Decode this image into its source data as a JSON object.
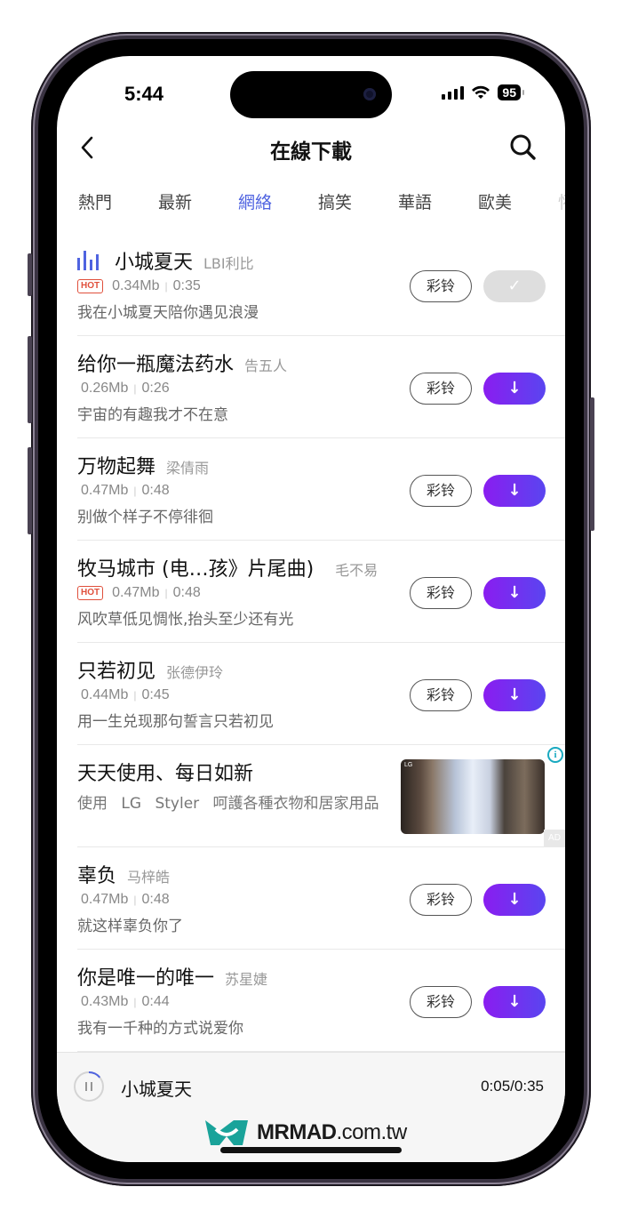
{
  "status_bar": {
    "time": "5:44",
    "battery": "95"
  },
  "header": {
    "title": "在線下載",
    "back_icon": "chevron-left-icon",
    "search_icon": "search-icon"
  },
  "tabs": [
    {
      "label": "熱門",
      "active": false
    },
    {
      "label": "最新",
      "active": false
    },
    {
      "label": "網絡",
      "active": true
    },
    {
      "label": "搞笑",
      "active": false
    },
    {
      "label": "華語",
      "active": false
    },
    {
      "label": "歐美",
      "active": false
    },
    {
      "label": "怀",
      "active": false
    }
  ],
  "songs": [
    {
      "title": "小城夏天",
      "artist": "LBI利比",
      "hot": true,
      "size": "0.34Mb",
      "duration": "0:35",
      "lyric": "我在小城夏天陪你遇见浪漫",
      "playing": true,
      "downloaded": true,
      "ring_label": "彩铃"
    },
    {
      "title": "给你一瓶魔法药水",
      "artist": "告五人",
      "hot": false,
      "size": "0.26Mb",
      "duration": "0:26",
      "lyric": "宇宙的有趣我才不在意",
      "playing": false,
      "downloaded": false,
      "ring_label": "彩铃"
    },
    {
      "title": "万物起舞",
      "artist": "梁倩雨",
      "hot": false,
      "size": "0.47Mb",
      "duration": "0:48",
      "lyric": "别做个样子不停徘徊",
      "playing": false,
      "downloaded": false,
      "ring_label": "彩铃"
    },
    {
      "title": "牧马城市 (电…孩》片尾曲)",
      "artist": "毛不易",
      "hot": true,
      "size": "0.47Mb",
      "duration": "0:48",
      "lyric": "风吹草低见惆怅,抬头至少还有光",
      "playing": false,
      "downloaded": false,
      "ring_label": "彩铃"
    },
    {
      "title": "只若初见",
      "artist": "张德伊玲",
      "hot": false,
      "size": "0.44Mb",
      "duration": "0:45",
      "lyric": "用一生兑现那句誓言只若初见",
      "playing": false,
      "downloaded": false,
      "ring_label": "彩铃"
    }
  ],
  "ad": {
    "title": "天天使用、每日如新",
    "description": "使用 LG Styler 呵護各種衣物和居家用品",
    "image_label": "LG",
    "badge": "AD",
    "info_icon": "i"
  },
  "songs_after_ad": [
    {
      "title": "辜负",
      "artist": "马梓皓",
      "hot": false,
      "size": "0.47Mb",
      "duration": "0:48",
      "lyric": "就这样辜负你了",
      "playing": false,
      "downloaded": false,
      "ring_label": "彩铃"
    },
    {
      "title": "你是唯一的唯一",
      "artist": "苏星婕",
      "hot": false,
      "size": "0.43Mb",
      "duration": "0:44",
      "lyric": "我有一千种的方式说爱你",
      "playing": false,
      "downloaded": false,
      "ring_label": "彩铃"
    }
  ],
  "hot_badge_label": "HOT",
  "separator": "|",
  "download_glyph": "↓",
  "downloaded_glyph": "✓",
  "player": {
    "title": "小城夏天",
    "time": "0:05/0:35",
    "progress": 0.14
  },
  "watermark": {
    "brand": "MRMAD",
    "domain": ".com.tw"
  },
  "colors": {
    "accent": "#4f63e0",
    "download_gradient_start": "#8a1df0",
    "download_gradient_end": "#5a45f0",
    "hot": "#e0503c",
    "watermark_teal": "#1aa39a"
  }
}
